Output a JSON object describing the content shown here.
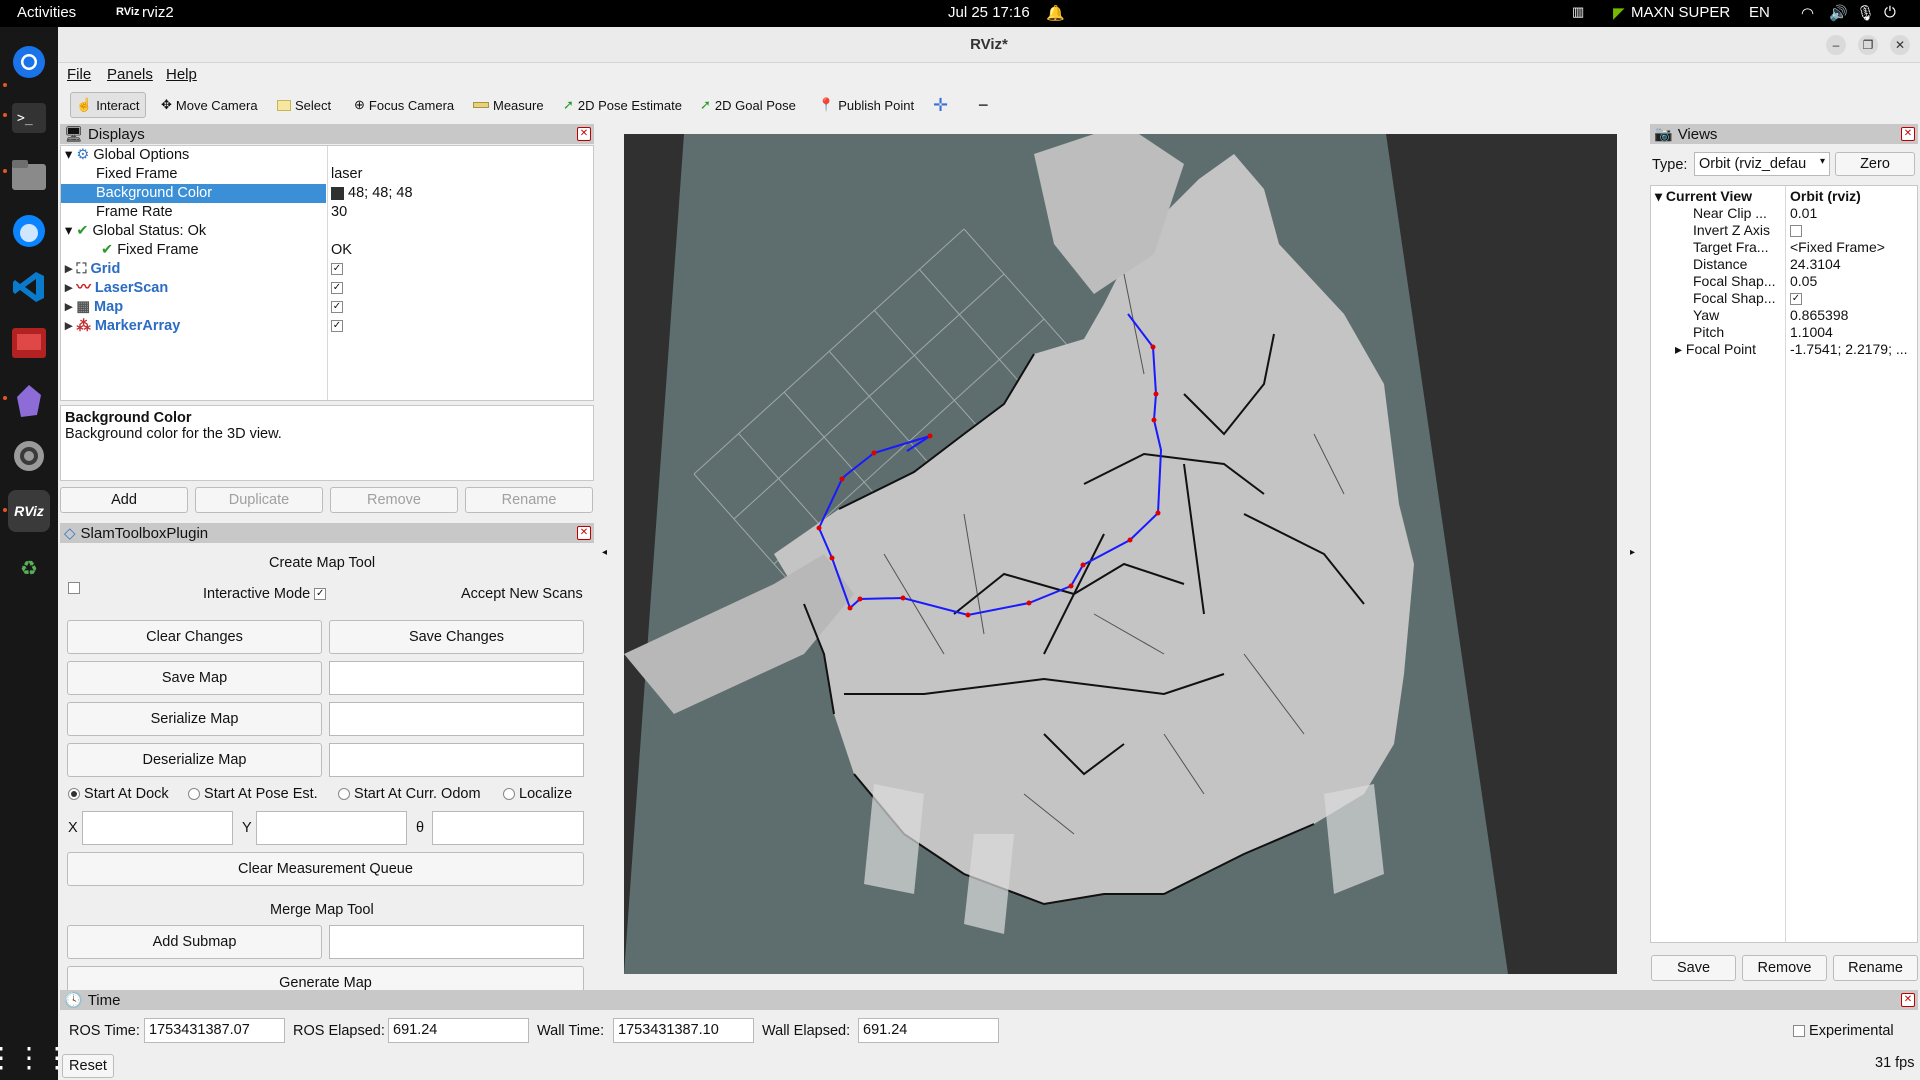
{
  "topbar": {
    "activities": "Activities",
    "app": "rviz2",
    "app_icon": "RViz",
    "clock": "Jul 25  17:16",
    "power_mode": "MAXN SUPER",
    "lang": "EN"
  },
  "window": {
    "title": "RViz*"
  },
  "menu": [
    "File",
    "Panels",
    "Help"
  ],
  "toolbar": {
    "interact": "Interact",
    "move_camera": "Move Camera",
    "select": "Select",
    "focus_camera": "Focus Camera",
    "measure": "Measure",
    "pose_estimate": "2D Pose Estimate",
    "goal_pose": "2D Goal Pose",
    "publish_point": "Publish Point"
  },
  "displays": {
    "title": "Displays",
    "global_options": "Global Options",
    "fixed_frame_label": "Fixed Frame",
    "fixed_frame_value": "laser",
    "bg_color_label": "Background Color",
    "bg_color_value": "48; 48; 48",
    "frame_rate_label": "Frame Rate",
    "frame_rate_value": "30",
    "global_status": "Global Status: Ok",
    "fixed_frame_status_label": "Fixed Frame",
    "fixed_frame_status_value": "OK",
    "items": [
      "Grid",
      "LaserScan",
      "Map",
      "MarkerArray"
    ],
    "desc_title": "Background Color",
    "desc_text": "Background color for the 3D view.",
    "buttons": {
      "add": "Add",
      "duplicate": "Duplicate",
      "remove": "Remove",
      "rename": "Rename"
    }
  },
  "slam": {
    "title": "SlamToolboxPlugin",
    "create_map_tool": "Create Map Tool",
    "interactive_mode": "Interactive Mode",
    "accept_new_scans": "Accept New Scans",
    "clear_changes": "Clear Changes",
    "save_changes": "Save Changes",
    "save_map": "Save Map",
    "serialize_map": "Serialize Map",
    "deserialize_map": "Deserialize Map",
    "start_at_dock": "Start At Dock",
    "start_at_pose_est": "Start At Pose Est.",
    "start_at_curr_odom": "Start At Curr. Odom",
    "localize": "Localize",
    "x": "X",
    "y": "Y",
    "theta": "θ",
    "clear_measurement_queue": "Clear Measurement Queue",
    "merge_map_tool": "Merge Map Tool",
    "add_submap": "Add Submap",
    "generate_map": "Generate Map"
  },
  "views": {
    "title": "Views",
    "type_label": "Type:",
    "type_value": "Orbit (rviz_defau",
    "zero": "Zero",
    "current_view": "Current View",
    "current_view_value": "Orbit (rviz)",
    "props": [
      {
        "k": "Near Clip ...",
        "v": "0.01"
      },
      {
        "k": "Invert Z Axis",
        "v": ""
      },
      {
        "k": "Target Fra...",
        "v": "<Fixed Frame>"
      },
      {
        "k": "Distance",
        "v": "24.3104"
      },
      {
        "k": "Focal Shap...",
        "v": "0.05"
      },
      {
        "k": "Focal Shap...",
        "v": ""
      },
      {
        "k": "Yaw",
        "v": "0.865398"
      },
      {
        "k": "Pitch",
        "v": "1.1004"
      },
      {
        "k": "Focal Point",
        "v": "-1.7541; 2.2179; ..."
      }
    ],
    "save": "Save",
    "remove": "Remove",
    "rename": "Rename"
  },
  "time": {
    "title": "Time",
    "ros_time_label": "ROS Time:",
    "ros_time": "1753431387.07",
    "ros_elapsed_label": "ROS Elapsed:",
    "ros_elapsed": "691.24",
    "wall_time_label": "Wall Time:",
    "wall_time": "1753431387.10",
    "wall_elapsed_label": "Wall Elapsed:",
    "wall_elapsed": "691.24",
    "experimental": "Experimental",
    "reset": "Reset",
    "fps": "31 fps"
  },
  "colors": {
    "selection": "#3a8fd6",
    "viewport_bg": "#303030",
    "map_free": "#c4c4c4",
    "map_unknown": "#5e6e6e",
    "path": "#1a1aff",
    "path_points": "#e00000"
  }
}
